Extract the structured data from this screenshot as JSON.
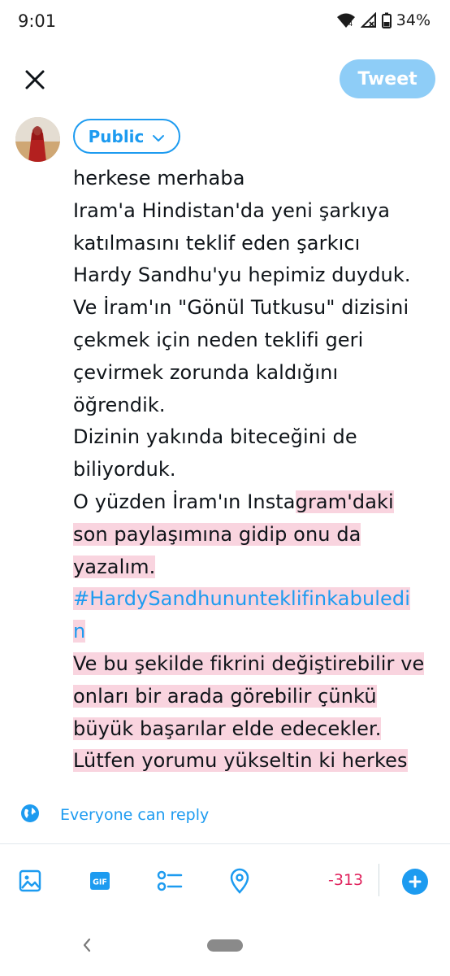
{
  "status_bar": {
    "time": "9:01",
    "battery": "34%"
  },
  "header": {
    "tweet_label": "Tweet"
  },
  "audience": {
    "label": "Public"
  },
  "composer": {
    "lines": [
      "herkese merhaba",
      "Iram'a Hindistan'da yeni şarkıya",
      "katılmasını teklif eden şarkıcı",
      "Hardy Sandhu'yu hepimiz duyduk.",
      "Ve İram'ın \"Gönül Tutkusu\" dizisini",
      "çekmek için neden teklifi geri",
      "çevirmek zorunda kaldığını",
      "öğrendik.",
      "Dizinin yakında biteceğini de",
      "biliyorduk.",
      "O yüzden İram'ın Insta",
      "gram'daki",
      "son paylaşımına gidip onu da",
      "yazalım.",
      "#HardySandhununteklifinkabuledi",
      "n",
      "Ve bu şekilde fikrini değiştirebilir ve",
      "onları bir arada görebilir çünkü",
      "büyük başarılar elde edecekler.",
      "Lütfen yorumu yükseltin ki herkes"
    ]
  },
  "reply_settings": {
    "label": "Everyone can reply"
  },
  "toolbar": {
    "char_counter": "-313"
  },
  "colors": {
    "accent": "#1d9bf0",
    "tweet_button_disabled": "#8ecdf7",
    "overflow_highlight": "#f9d4df",
    "counter_over_limit": "#e0245e"
  }
}
